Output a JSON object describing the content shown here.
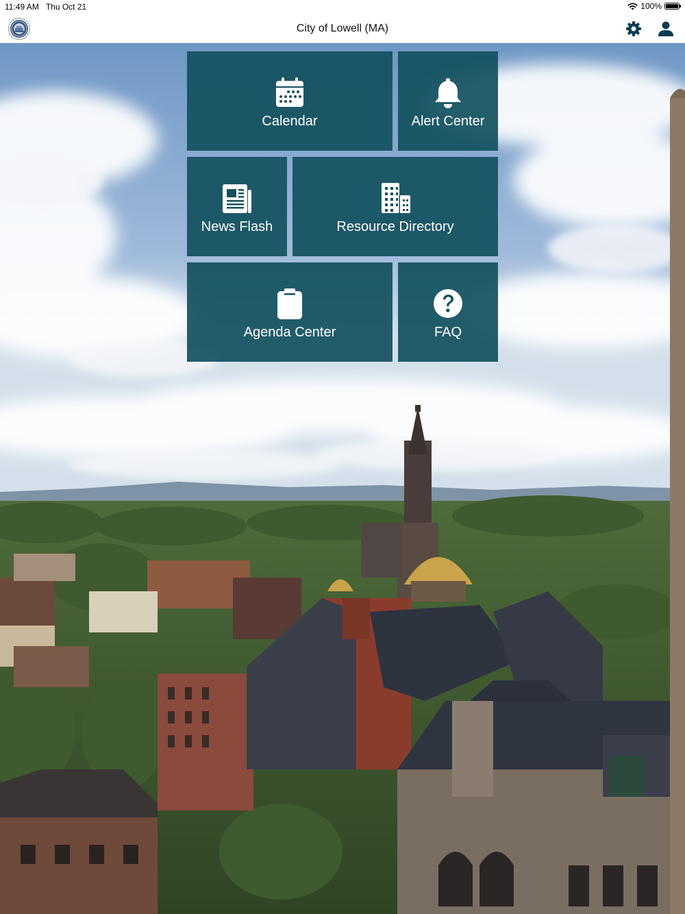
{
  "status_bar": {
    "time": "11:49 AM",
    "date": "Thu Oct 21",
    "battery_percent": "100%",
    "battery_level": 1.0
  },
  "nav": {
    "title": "City of Lowell (MA)",
    "left_icon": "city-seal-logo",
    "right_icons": [
      "gear-icon",
      "person-icon"
    ]
  },
  "tiles": [
    {
      "label": "Calendar",
      "icon": "calendar-icon"
    },
    {
      "label": "Alert Center",
      "icon": "bell-icon"
    },
    {
      "label": "News Flash",
      "icon": "newspaper-icon"
    },
    {
      "label": "Resource Directory",
      "icon": "buildings-icon"
    },
    {
      "label": "Agenda Center",
      "icon": "clipboard-icon"
    },
    {
      "label": "FAQ",
      "icon": "question-circle-icon"
    }
  ],
  "colors": {
    "tile_background": "#12505E",
    "tile_text": "#FFFFFF",
    "nav_icon": "#0D3B56",
    "sky": "#7FA6CF"
  }
}
